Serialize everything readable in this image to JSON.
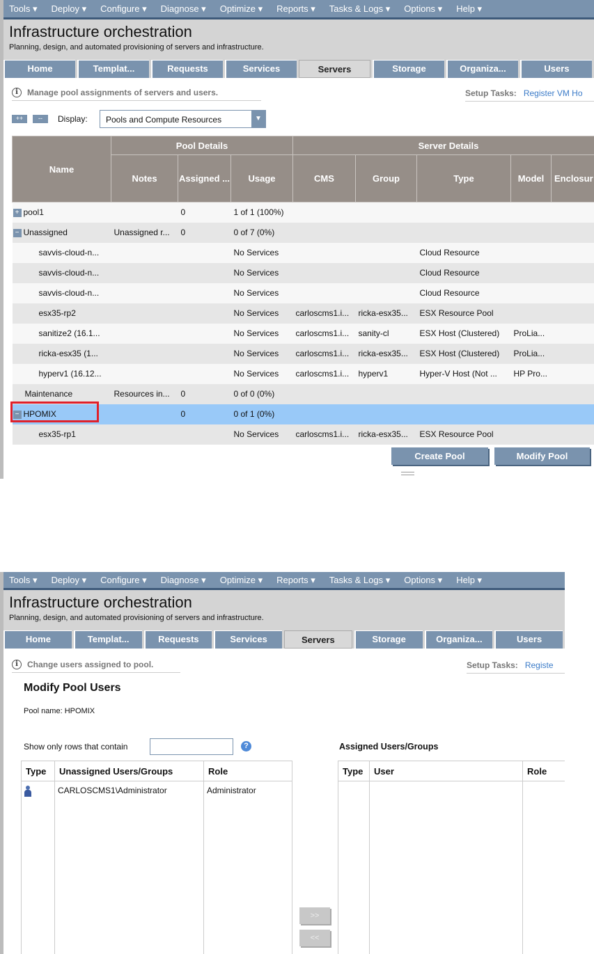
{
  "menu": [
    "Tools ▾",
    "Deploy ▾",
    "Configure ▾",
    "Diagnose ▾",
    "Optimize ▾",
    "Reports ▾",
    "Tasks & Logs ▾",
    "Options ▾",
    "Help ▾"
  ],
  "title": "Infrastructure orchestration",
  "subtitle": "Planning, design, and automated provisioning of servers and infrastructure.",
  "tabs": [
    "Home",
    "Templat...",
    "Requests",
    "Services",
    "Servers",
    "Storage",
    "Organiza...",
    "Users"
  ],
  "active_tab": "Servers",
  "setup_label": "Setup Tasks:",
  "screen1": {
    "info": "Manage pool assignments of servers and users.",
    "setup_link": "Register VM Ho",
    "expand_all": "++",
    "collapse_all": "--",
    "display_label": "Display:",
    "display_value": "Pools and Compute Resources",
    "group_headers": {
      "pool": "Pool Details",
      "server": "Server Details"
    },
    "columns": [
      "Name",
      "Notes",
      "Assigned ...",
      "Usage",
      "CMS",
      "Group",
      "Type",
      "Model",
      "Enclosur"
    ],
    "rows": [
      {
        "name": "pool1",
        "toggle": "+",
        "notes": "",
        "assigned": "0",
        "usage": "1 of 1 (100%)",
        "cms": "",
        "group": "",
        "type": "",
        "model": ""
      },
      {
        "name": "Unassigned",
        "toggle": "-",
        "notes": "Unassigned r...",
        "assigned": "0",
        "usage": "0 of 7 (0%)",
        "cms": "",
        "group": "",
        "type": "",
        "model": ""
      },
      {
        "name": "savvis-cloud-n...",
        "notes": "",
        "assigned": "",
        "usage": "No Services",
        "cms": "",
        "group": "",
        "type": "Cloud Resource",
        "model": ""
      },
      {
        "name": "savvis-cloud-n...",
        "notes": "",
        "assigned": "",
        "usage": "No Services",
        "cms": "",
        "group": "",
        "type": "Cloud Resource",
        "model": ""
      },
      {
        "name": "savvis-cloud-n...",
        "notes": "",
        "assigned": "",
        "usage": "No Services",
        "cms": "",
        "group": "",
        "type": "Cloud Resource",
        "model": ""
      },
      {
        "name": "esx35-rp2",
        "notes": "",
        "assigned": "",
        "usage": "No Services",
        "cms": "carloscms1.i...",
        "group": "ricka-esx35...",
        "type": "ESX Resource Pool",
        "model": ""
      },
      {
        "name": "sanitize2 (16.1...",
        "notes": "",
        "assigned": "",
        "usage": "No Services",
        "cms": "carloscms1.i...",
        "group": "sanity-cl",
        "type": "ESX Host (Clustered)",
        "model": "ProLia..."
      },
      {
        "name": "ricka-esx35 (1...",
        "notes": "",
        "assigned": "",
        "usage": "No Services",
        "cms": "carloscms1.i...",
        "group": "ricka-esx35...",
        "type": "ESX Host (Clustered)",
        "model": "ProLia..."
      },
      {
        "name": "hyperv1 (16.12...",
        "notes": "",
        "assigned": "",
        "usage": "No Services",
        "cms": "carloscms1.i...",
        "group": "hyperv1",
        "type": "Hyper-V Host (Not ...",
        "model": "HP Pro..."
      },
      {
        "name": "Maintenance",
        "notes": "Resources in...",
        "assigned": "0",
        "usage": "0 of 0 (0%)",
        "cms": "",
        "group": "",
        "type": "",
        "model": ""
      },
      {
        "name": "HPOMIX",
        "toggle": "-",
        "notes": "",
        "assigned": "0",
        "usage": "0 of 1 (0%)",
        "cms": "",
        "group": "",
        "type": "",
        "model": "",
        "selected": true
      },
      {
        "name": "esx35-rp1",
        "notes": "",
        "assigned": "",
        "usage": "No Services",
        "cms": "carloscms1.i...",
        "group": "ricka-esx35...",
        "type": "ESX Resource Pool",
        "model": ""
      }
    ],
    "create_pool": "Create Pool",
    "modify_pool": "Modify Pool"
  },
  "screen2": {
    "info": "Change users assigned to pool.",
    "setup_link": "Registe",
    "heading": "Modify Pool Users",
    "pool_name": "Pool name: HPOMIX",
    "filter_label": "Show only rows that contain",
    "filter_value": "",
    "help": "?",
    "assigned_heading": "Assigned Users/Groups",
    "left_columns": [
      "Type",
      "Unassigned Users/Groups",
      "Role"
    ],
    "left_rows": [
      {
        "user": "CARLOSCMS1\\Administrator",
        "role": "Administrator"
      }
    ],
    "right_columns": [
      "Type",
      "User",
      "Role"
    ],
    "add": ">>",
    "remove": "<<"
  }
}
